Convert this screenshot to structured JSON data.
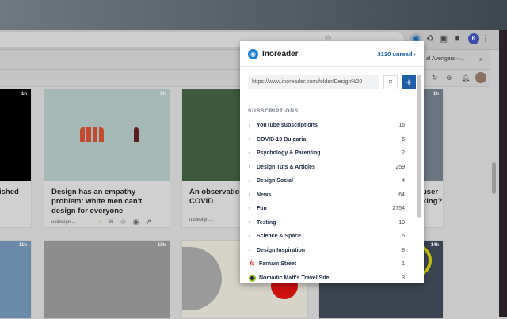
{
  "browser": {
    "bookmark_text": "al Avengers -...",
    "bookmarks_overflow": "»",
    "avatar_letter": "K"
  },
  "cards": [
    {
      "title": "ished",
      "age": "1h"
    },
    {
      "title": "Design has an empathy problem: white men can't design for everyone",
      "age": "1h",
      "source": "uxdesign....",
      "popularity": "36"
    },
    {
      "title": "An observation, solution — COVID",
      "source": "uxdesign...."
    },
    {
      "title": "user king?",
      "age": "1h"
    },
    {
      "age": "11h"
    },
    {
      "age": "11h"
    },
    {},
    {
      "age": "14h"
    }
  ],
  "popup": {
    "brand": "Inoreader",
    "unread": "3130 unread",
    "url": "https://www.inoreader.com/folder/Design%20",
    "subscriptions_label": "SUBSCRIPTIONS",
    "items": [
      {
        "name": "YouTube subscriptions",
        "count": "16"
      },
      {
        "name": "COVID-19 Bulgaria",
        "count": "6"
      },
      {
        "name": "Psychology & Parenting",
        "count": "2"
      },
      {
        "name": "Design Tuts & Articles",
        "count": "259"
      },
      {
        "name": "Design Social",
        "count": "4"
      },
      {
        "name": "News",
        "count": "64"
      },
      {
        "name": "Fun",
        "count": "2754"
      },
      {
        "name": "Testing",
        "count": "19"
      },
      {
        "name": "Science & Space",
        "count": "5"
      },
      {
        "name": "Design Inspiration",
        "count": "8"
      },
      {
        "name": "Farnam Street",
        "count": "1"
      },
      {
        "name": "Nomadic Matt's Travel Site",
        "count": "3"
      }
    ]
  }
}
